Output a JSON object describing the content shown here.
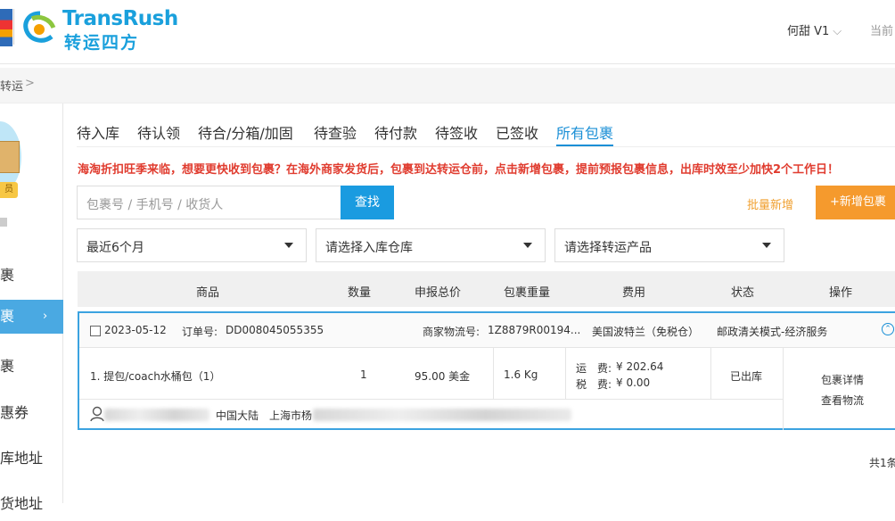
{
  "header": {
    "logo_en": "TransRush",
    "logo_cn": "转运四方",
    "user_name": "何甜 V1",
    "current_label": "当前"
  },
  "breadcrumb": {
    "item": "转运",
    "sep": ">"
  },
  "sidebar": {
    "vip_label": "员",
    "items": [
      {
        "label": "裹",
        "active": false
      },
      {
        "label": "裹",
        "active": true
      },
      {
        "label": "裹",
        "active": false
      },
      {
        "label": "惠券",
        "active": false
      },
      {
        "label": "库地址",
        "active": false
      },
      {
        "label": "货地址",
        "active": false
      }
    ]
  },
  "tabs": [
    "待入库",
    "待认领",
    "待合/分箱/加固",
    "待查验",
    "待付款",
    "待签收",
    "已签收",
    "所有包裹"
  ],
  "active_tab": "所有包裹",
  "notice": "海淘折扣旺季来临，想要更快收到包裹？在海外商家发货后，包裹到达转运仓前，点击新增包裹，提前预报包裹信息，出库时效至少加快2个工作日！",
  "search": {
    "placeholder": "包裹号 / 手机号 / 收货人",
    "button": "查找"
  },
  "actions": {
    "batch_add": "批量新增",
    "add": "+新增包裹"
  },
  "filters": {
    "period": "最近6个月",
    "warehouse": "请选择入库仓库",
    "product": "请选择转运产品"
  },
  "table": {
    "headers": [
      "商品",
      "数量",
      "申报总价",
      "包裹重量",
      "费用",
      "状态",
      "操作"
    ]
  },
  "order": {
    "date": "2023-05-12",
    "order_label": "订单号:",
    "order_no": "DD008045055355",
    "tracking_label": "商家物流号:",
    "tracking_no": "1Z8879R00194...",
    "warehouse": "美国波特兰（免税仓）",
    "service": "邮政清关模式-经济服务",
    "item": "1. 提包/coach水桶包（1）",
    "qty": "1",
    "declared": "95.00 美金",
    "weight": "1.6 Kg",
    "freight_label": "运　费:",
    "freight": "¥ 202.64",
    "tax_label": "税　费:",
    "tax": "¥ 0.00",
    "status": "已出库",
    "op_detail": "包裹详情",
    "op_track": "查看物流",
    "country": "中国大陆",
    "city": "上海市杨"
  },
  "pagination": {
    "total": "共1条"
  },
  "colors": {
    "accent": "#1a8fd6",
    "orange": "#f59a2d",
    "red": "#e03c2f"
  }
}
